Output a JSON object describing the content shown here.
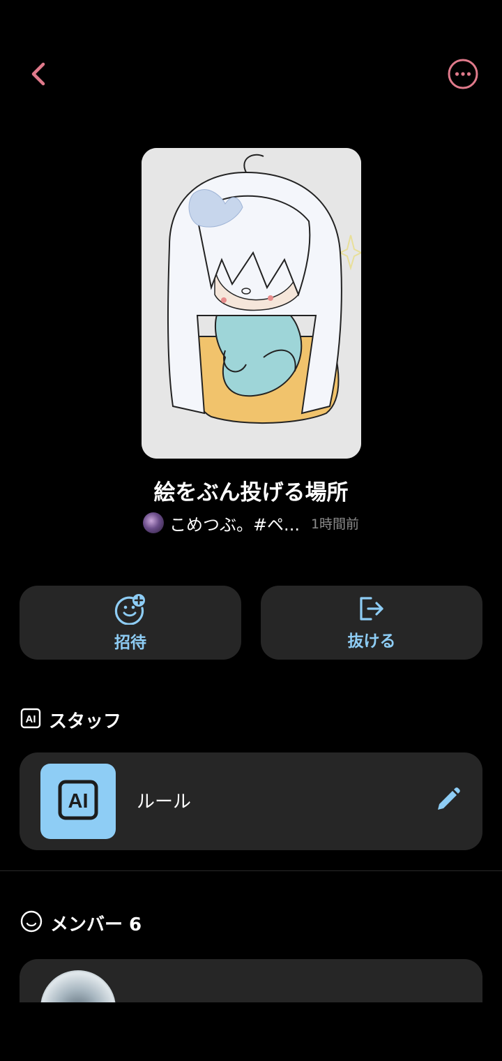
{
  "header": {
    "back_icon": "chevron-left-icon",
    "more_icon": "more-horizontal-circle-icon",
    "accent_color": "#e07a8b"
  },
  "room": {
    "title": "絵をぶん投げる場所",
    "owner_name": "こめつぶ。#ペ...",
    "updated": "1時間前"
  },
  "actions": {
    "invite_label": "招待",
    "leave_label": "抜ける",
    "accent_color": "#8ecdf5"
  },
  "staff_section": {
    "title": "スタッフ",
    "icon": "ai-badge-icon",
    "items": [
      {
        "name": "ルール",
        "icon": "ai-badge-icon",
        "action_icon": "pencil-icon"
      }
    ]
  },
  "member_section": {
    "title": "メンバー 6",
    "icon": "smiley-icon",
    "items": [
      {
        "name": ""
      }
    ]
  }
}
